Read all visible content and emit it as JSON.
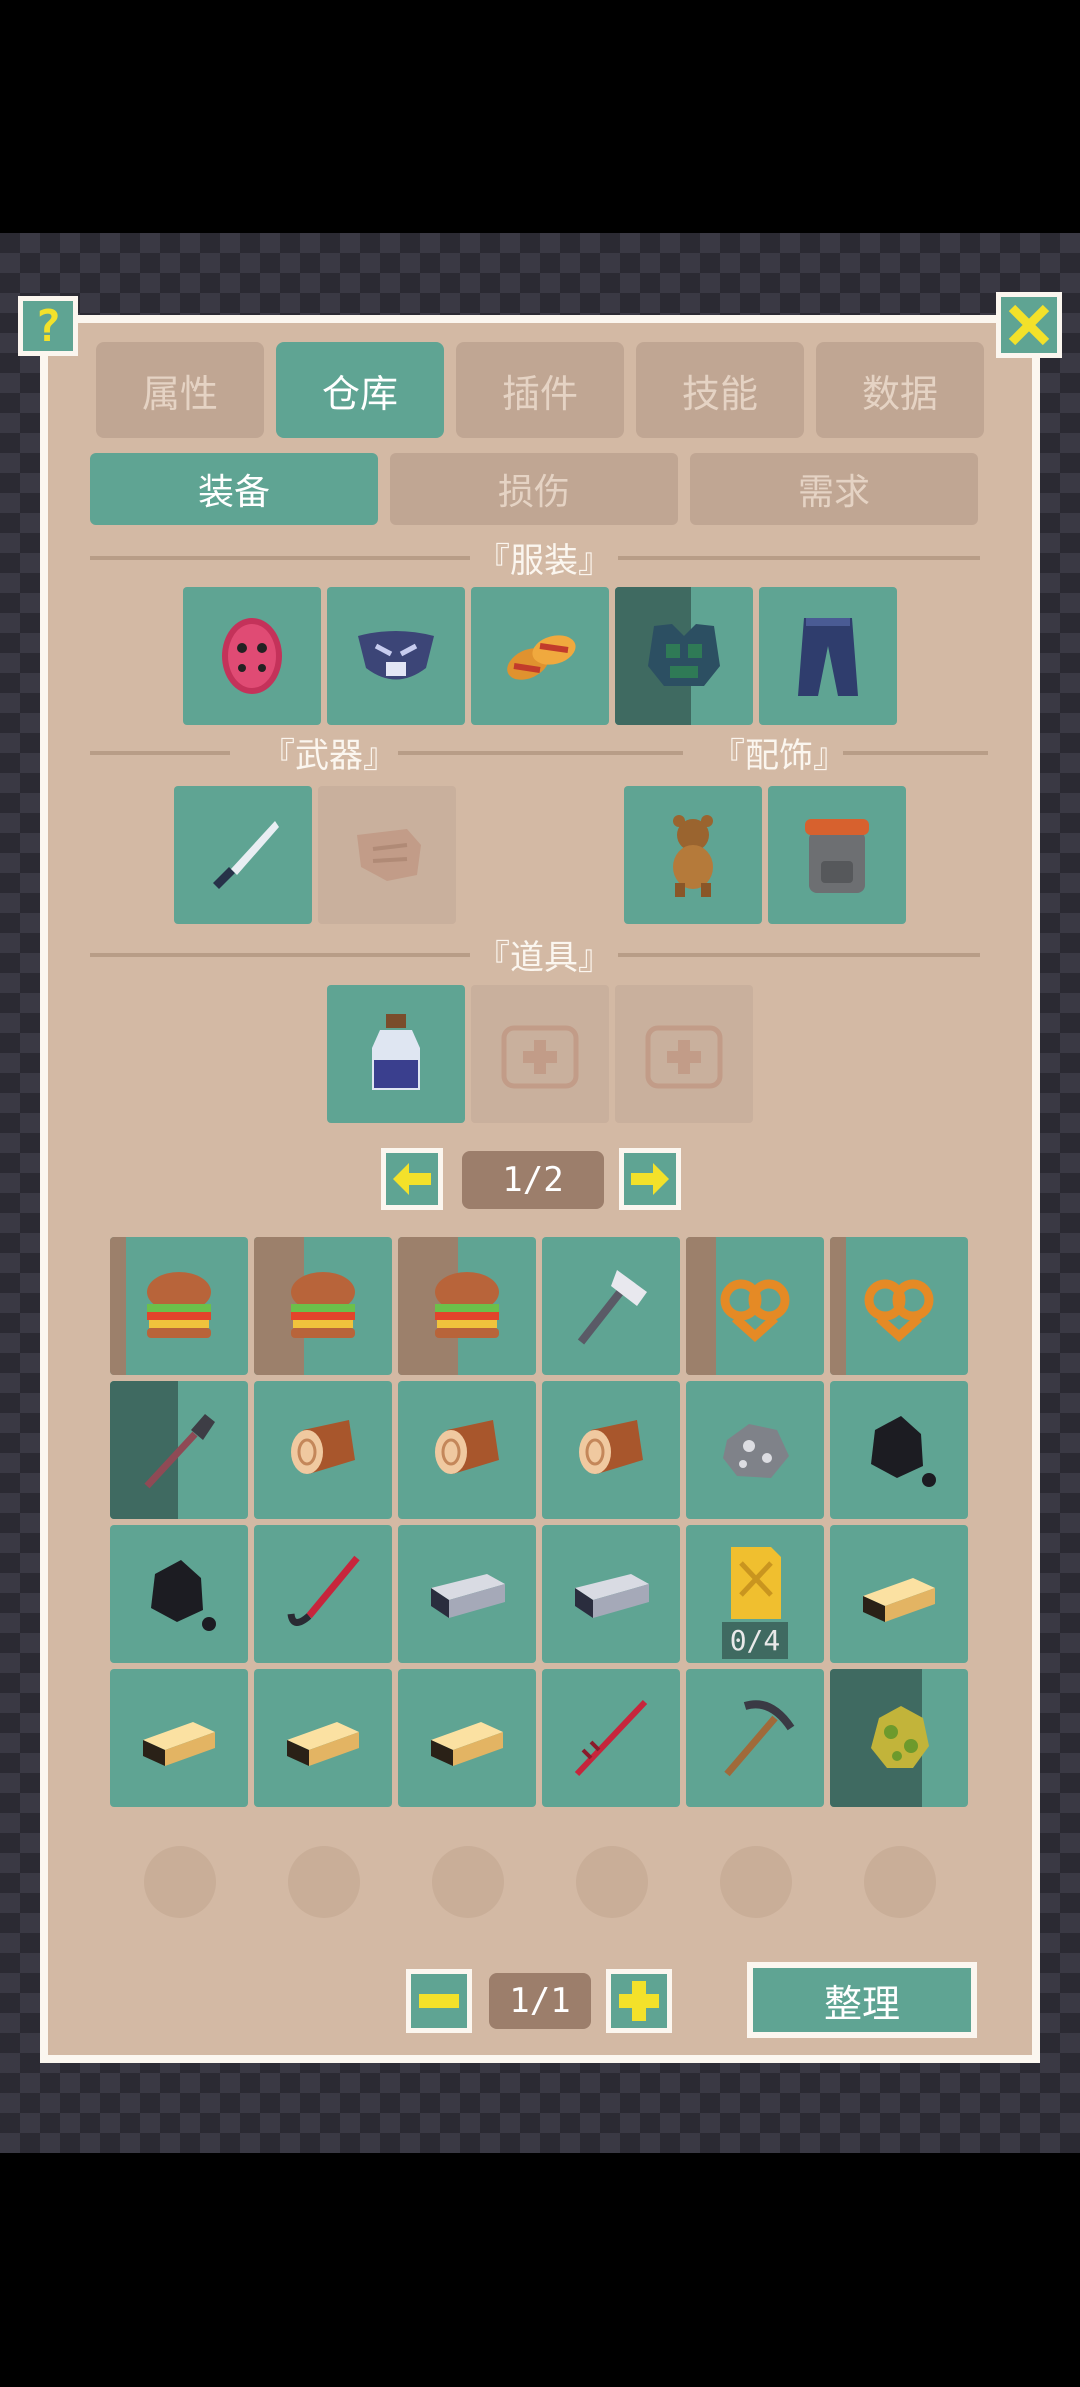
{
  "tabs": [
    {
      "label": "属性",
      "active": false
    },
    {
      "label": "仓库",
      "active": true
    },
    {
      "label": "插件",
      "active": false
    },
    {
      "label": "技能",
      "active": false
    },
    {
      "label": "数据",
      "active": false
    }
  ],
  "subtabs": [
    {
      "label": "装备",
      "active": true
    },
    {
      "label": "损伤",
      "active": false
    },
    {
      "label": "需求",
      "active": false
    }
  ],
  "sections": {
    "clothing": "『服装』",
    "weapons": "『武器』",
    "accessories": "『配饰』",
    "tools": "『道具』"
  },
  "icons": {
    "help": "?",
    "close": "close-icon",
    "prev": "arrow-left-icon",
    "next": "arrow-right-icon",
    "minus": "minus-icon",
    "plus": "plus-icon"
  },
  "clothing_slots": [
    "mask",
    "muzzle-mask",
    "sandals",
    "armor-vest",
    "pants"
  ],
  "weapon_slots": [
    "knife",
    "fist-empty"
  ],
  "accessory_slots": [
    "teddy-bear",
    "backpack"
  ],
  "tool_slots": [
    "potion-bottle",
    "medkit-empty",
    "medkit-empty"
  ],
  "equip_pager": "1/2",
  "inventory": [
    {
      "item": "burger"
    },
    {
      "item": "burger"
    },
    {
      "item": "burger"
    },
    {
      "item": "axe"
    },
    {
      "item": "pretzel"
    },
    {
      "item": "pretzel"
    },
    {
      "item": "shovel"
    },
    {
      "item": "log"
    },
    {
      "item": "log"
    },
    {
      "item": "log"
    },
    {
      "item": "ore"
    },
    {
      "item": "coal"
    },
    {
      "item": "coal"
    },
    {
      "item": "crowbar"
    },
    {
      "item": "iron-bar"
    },
    {
      "item": "iron-bar"
    },
    {
      "item": "gas-can",
      "count": "0/4"
    },
    {
      "item": "gold-bar"
    },
    {
      "item": "gold-bar"
    },
    {
      "item": "gold-bar"
    },
    {
      "item": "gold-bar"
    },
    {
      "item": "red-spear"
    },
    {
      "item": "pickaxe"
    },
    {
      "item": "herb"
    }
  ],
  "inventory_pager": "1/1",
  "sort_label": "整理",
  "colors": {
    "accent": "#5fa493",
    "panel": "#d3b9a4",
    "yellow": "#f3e12a"
  }
}
